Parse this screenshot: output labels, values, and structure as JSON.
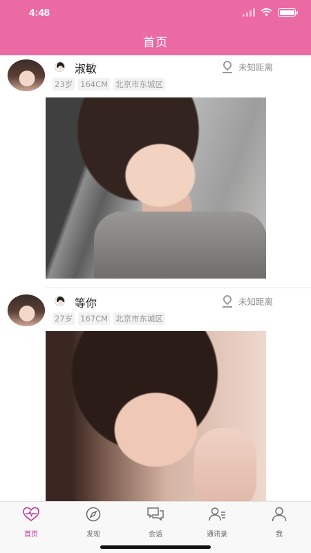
{
  "status_bar": {
    "time": "4:48"
  },
  "header": {
    "title": "首页"
  },
  "posts": [
    {
      "name": "淑敏",
      "age": "23岁",
      "height": "164CM",
      "location": "北京市东城区",
      "distance": "未知距离"
    },
    {
      "name": "等你",
      "age": "27岁",
      "height": "167CM",
      "location": "北京市东城区",
      "distance": "未知距离"
    }
  ],
  "tabbar": {
    "items": [
      {
        "label": "首页",
        "icon": "heart-pulse-icon",
        "active": true
      },
      {
        "label": "发现",
        "icon": "compass-icon"
      },
      {
        "label": "会话",
        "icon": "chat-bubbles-icon"
      },
      {
        "label": "通讯录",
        "icon": "contacts-icon"
      },
      {
        "label": "我",
        "icon": "person-icon"
      }
    ],
    "active_color": "#c0339b",
    "inactive_color": "#6d6d6d"
  },
  "colors": {
    "brand": "#ec6aa4"
  }
}
